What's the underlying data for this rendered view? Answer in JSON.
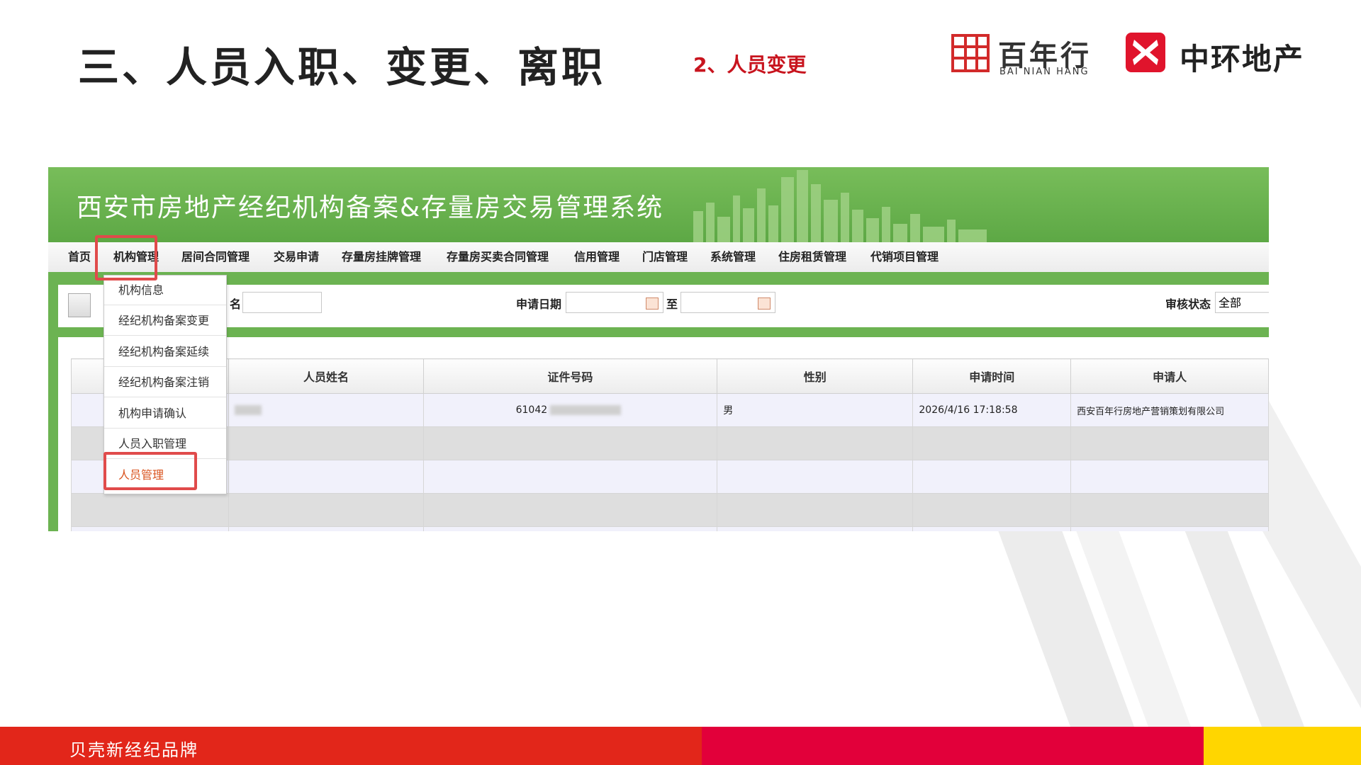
{
  "slide": {
    "title": "三、人员入职、变更、离职",
    "subtitle": "2、人员变更",
    "footer": "贝壳新经纪品牌",
    "colors": {
      "title": "#222222",
      "subtitle": "#c8141e",
      "footer_red": "#e2261a",
      "footer_crimson": "#e2003a",
      "footer_yellow": "#ffd600"
    }
  },
  "logos": {
    "bainianhang": {
      "cn": "百年行",
      "en": "BAI NIAN HANG",
      "color": "#d22a2a"
    },
    "zhonghuan": {
      "cn": "中环地产",
      "color": "#e0142c"
    }
  },
  "system": {
    "title": "西安市房地产经纪机构备案&存量房交易管理系统",
    "nav": [
      "首页",
      "机构管理",
      "居间合同管理",
      "交易申请",
      "存量房挂牌管理",
      "存量房买卖合同管理",
      "信用管理",
      "门店管理",
      "系统管理",
      "住房租赁管理",
      "代销项目管理"
    ],
    "dropdown": [
      "机构信息",
      "经纪机构备案变更",
      "经纪机构备案延续",
      "经纪机构备案注销",
      "机构申请确认",
      "人员入职管理",
      "人员管理"
    ],
    "filters": {
      "name_label": "名",
      "date_label": "申请日期",
      "to_label": "至",
      "status_label": "审核状态",
      "status_value": "全部"
    },
    "table": {
      "headers": [
        "",
        "人员姓名",
        "证件号码",
        "性别",
        "申请时间",
        "申请人"
      ],
      "rows": [
        {
          "name": "",
          "id": "61042",
          "gender": "男",
          "time": "2026/4/16 17:18:58",
          "applicant": "西安百年行房地产营销策划有限公司"
        }
      ]
    },
    "colors": {
      "banner": "#6cb352",
      "highlight": "#e04b4b",
      "active_menu": "#d9531e"
    }
  }
}
